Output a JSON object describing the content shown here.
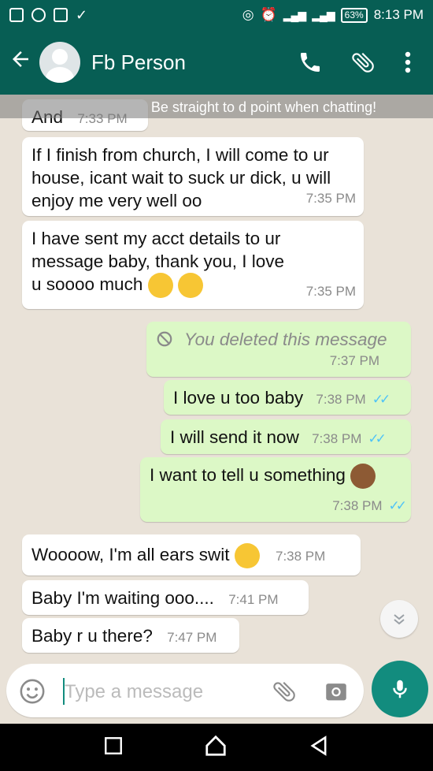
{
  "status_bar": {
    "battery": "63%",
    "time": "8:13 PM"
  },
  "header": {
    "back_icon": "arrow-left-icon",
    "contact_name": "Fb Person",
    "call_icon": "phone-icon",
    "attach_icon": "paperclip-icon",
    "menu_icon": "more-vertical-icon"
  },
  "banner": {
    "text": "Be straight to d point when chatting!"
  },
  "messages": [
    {
      "direction": "in",
      "text": "And",
      "time": "7:33 PM"
    },
    {
      "direction": "in",
      "text": "If I finish from church, I will come to ur house, icant wait to suck ur dick, u will enjoy me very well oo",
      "time": "7:35 PM"
    },
    {
      "direction": "in",
      "text": "I have sent my acct details to ur message baby, thank you, I love u soooo much",
      "time": "7:35 PM"
    },
    {
      "direction": "out",
      "text": "You deleted this message",
      "time": "7:37 PM"
    },
    {
      "direction": "out",
      "text": "I love u too baby",
      "time": "7:38 PM"
    },
    {
      "direction": "out",
      "text": "I will send it now",
      "time": "7:38 PM"
    },
    {
      "direction": "out",
      "text": "I want to tell u something",
      "time": "7:38 PM"
    },
    {
      "direction": "in",
      "text": "Woooow, I'm all ears swit",
      "time": "7:38 PM"
    },
    {
      "direction": "in",
      "text": "Baby I'm waiting ooo....",
      "time": "7:41 PM"
    },
    {
      "direction": "in",
      "text": "Baby r u there?",
      "time": "7:47 PM"
    }
  ],
  "input": {
    "placeholder": "Type a message",
    "emoji_icon": "smiley-icon",
    "attach_icon": "paperclip-icon",
    "camera_icon": "camera-icon",
    "mic_icon": "microphone-icon"
  },
  "colors": {
    "header": "#075e54",
    "outgoing_bubble": "#dcf8c6",
    "incoming_bubble": "#ffffff",
    "accent": "#128c7e",
    "read_tick": "#4fc3f7"
  }
}
